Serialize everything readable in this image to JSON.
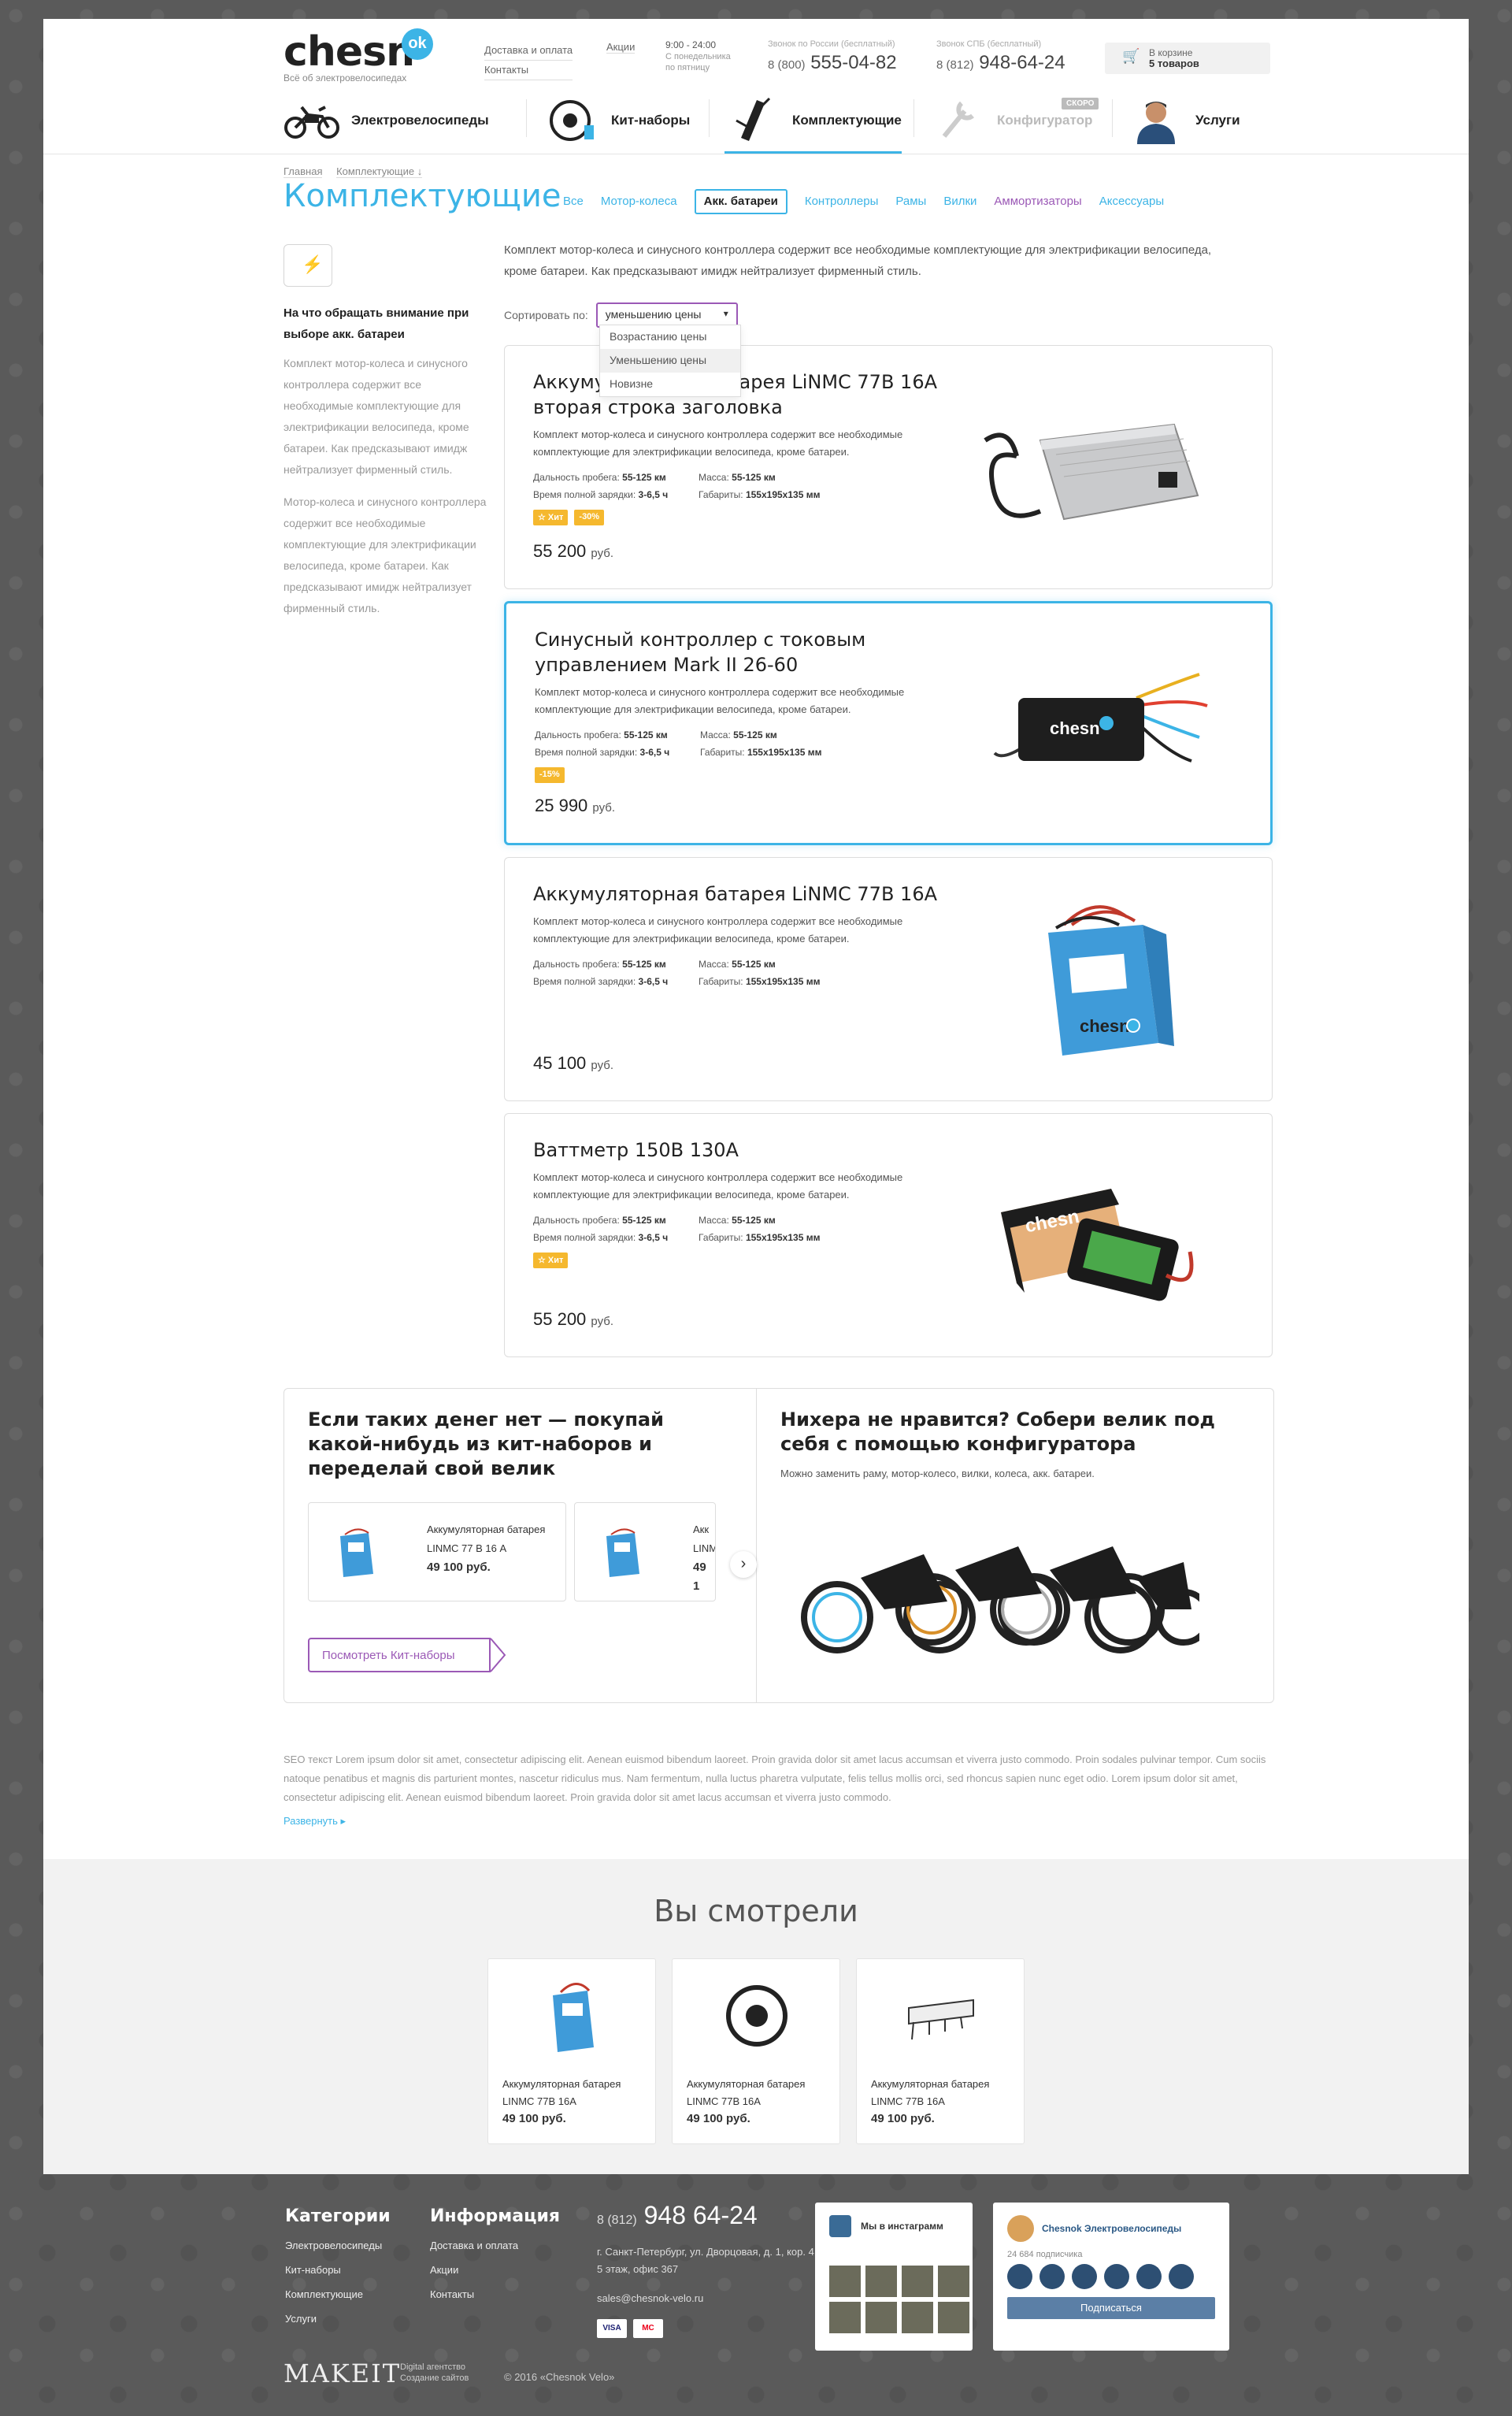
{
  "header": {
    "logo_text": "chesn",
    "logo_badge": "ok",
    "logo_sub": "Всё об электровелосипедах",
    "links": [
      "Доставка и оплата",
      "Контакты"
    ],
    "promo_link": "Акции",
    "hours_time": "9:00 - 24:00",
    "hours_days": "С понедельника\nпо пятницу",
    "phone_ru_label": "Звонок по России (бесплатный)",
    "phone_ru_code": "8 (800)",
    "phone_ru_num": "555-04-82",
    "phone_spb_label": "Звонок СПБ (бесплатный)",
    "phone_spb_code": "8 (812)",
    "phone_spb_num": "948-64-24",
    "cart_label": "В корзине",
    "cart_count": "5 товаров"
  },
  "nav": {
    "ebikes": "Электровелосипеды",
    "kits": "Кит-наборы",
    "parts": "Комплектующие",
    "configurator": "Конфигуратор",
    "soon": "СКОРО",
    "services": "Услуги"
  },
  "breadcrumbs": [
    "Главная",
    "Комплектующие ↓"
  ],
  "page_title": "Комплектующие",
  "categories": [
    "Все",
    "Мотор-колеса",
    "Акк. батареи",
    "Контроллеры",
    "Рамы",
    "Вилки",
    "Аммортизаторы",
    "Аксессуары"
  ],
  "sidebar": {
    "title": "На что обращать внимание при выборе акк. батареи",
    "text1": "Комплект мотор-колеса и синусного контроллера содержит все необходимые комплектующие для электрификации велосипеда, кроме батареи. Как предсказывают имидж нейтрализует фирменный стиль.",
    "text2": "Мотор-колеса и синусного контроллера содержит все необходимые комплектующие для электрификации велосипеда, кроме батареи. Как предсказывают имидж нейтрализует фирменный стиль."
  },
  "intro": "Комплект мотор-колеса и синусного контроллера содержит все необходимые комплектующие для электрификации велосипеда, кроме батареи. Как предсказывают имидж нейтрализует фирменный стиль.",
  "sort": {
    "label": "Сортировать по:",
    "selected": "уменьшению цены",
    "options": [
      "Возрастанию цены",
      "Уменьшению цены",
      "Новизне"
    ]
  },
  "products": [
    {
      "title": "Аккумуляторная батарея LiNMC 77В 16А вторая строка заголовка",
      "desc": "Комплект мотор-колеса и синусного контроллера содержит все необходимые комплектующие для электрификации велосипеда, кроме батареи.",
      "range_label": "Дальность пробега:",
      "range": "55-125 км",
      "mass_label": "Масса:",
      "mass": "55-125 км",
      "charge_label": "Время полной зарядки:",
      "charge": "3-6,5 ч",
      "size_label": "Габариты:",
      "size": "155х195х135 мм",
      "badges": [
        "☆ Хит",
        "-30%"
      ],
      "price": "55 200",
      "currency": "руб."
    },
    {
      "title": "Синусный контроллер с токовым управлением Mark II 26-60",
      "desc": "Комплект мотор-колеса и синусного контроллера содержит все необходимые комплектующие для электрификации велосипеда, кроме батареи.",
      "range_label": "Дальность пробега:",
      "range": "55-125 км",
      "mass_label": "Масса:",
      "mass": "55-125 км",
      "charge_label": "Время полной зарядки:",
      "charge": "3-6,5 ч",
      "size_label": "Габариты:",
      "size": "155х195х135 мм",
      "badges": [
        "-15%"
      ],
      "price": "25 990",
      "currency": "руб."
    },
    {
      "title": "Аккумуляторная батарея LiNMC 77В 16А",
      "desc": "Комплект мотор-колеса и синусного контроллера содержит все необходимые комплектующие для электрификации велосипеда, кроме батареи.",
      "range_label": "Дальность пробега:",
      "range": "55-125 км",
      "mass_label": "Масса:",
      "mass": "55-125 км",
      "charge_label": "Время полной зарядки:",
      "charge": "3-6,5 ч",
      "size_label": "Габариты:",
      "size": "155х195х135 мм",
      "badges": [],
      "price": "45 100",
      "currency": "руб."
    },
    {
      "title": "Ваттметр 150В 130А",
      "desc": "Комплект мотор-колеса и синусного контроллера содержит все необходимые комплектующие для электрификации велосипеда, кроме батареи.",
      "range_label": "Дальность пробега:",
      "range": "55-125 км",
      "mass_label": "Масса:",
      "mass": "55-125 км",
      "charge_label": "Время полной зарядки:",
      "charge": "3-6,5 ч",
      "size_label": "Габариты:",
      "size": "155х195х135 мм",
      "badges": [
        "☆ Хит"
      ],
      "price": "55 200",
      "currency": "руб."
    }
  ],
  "promo": {
    "left_title": "Если таких денег нет — покупай какой-нибудь из кит-наборов и переделай свой велик",
    "mini_name": "Аккумуляторная батарея LINMC 77 В 16 А",
    "mini_price": "49 100 руб.",
    "mini2_name": "Акк LINMC",
    "mini2_price": "49 1",
    "kit_button": "Посмотреть Кит-наборы",
    "right_title": "Нихера не нравится? Собери велик под себя с помощью конфигуратора",
    "right_sub": "Можно заменить раму, мотор-колесо, вилки, колеса, акк. батареи."
  },
  "seo": {
    "text": "SEO текст Lorem ipsum dolor sit amet, consectetur adipiscing elit. Aenean euismod bibendum laoreet. Proin gravida dolor sit amet lacus accumsan et viverra justo commodo. Proin sodales pulvinar tempor. Cum sociis natoque penatibus et magnis dis parturient montes, nascetur ridiculus mus. Nam fermentum, nulla luctus pharetra vulputate, felis tellus mollis orci, sed rhoncus sapien nunc eget odio. Lorem ipsum dolor sit amet, consectetur adipiscing elit. Aenean euismod bibendum laoreet. Proin gravida dolor sit amet lacus accumsan et viverra justo commodo.",
    "more": "Развернуть ▸"
  },
  "viewed": {
    "title": "Вы смотрели",
    "items": [
      {
        "name": "Аккумуляторная батарея LINMC 77В 16А",
        "price": "49 100 руб."
      },
      {
        "name": "Аккумуляторная батарея LINMC 77В 16А",
        "price": "49 100 руб."
      },
      {
        "name": "Аккумуляторная батарея LINMC 77В 16А",
        "price": "49 100 руб."
      }
    ]
  },
  "footer": {
    "categories_title": "Категории",
    "categories": [
      "Электровелосипеды",
      "Кит-наборы",
      "Комплектующие",
      "Услуги"
    ],
    "info_title": "Информация",
    "info": [
      "Доставка и оплата",
      "Акции",
      "Контакты"
    ],
    "phone_code": "8 (812)",
    "phone": "948 64-24",
    "address": "г. Санкт-Петербург, ул. Дворцовая, д. 1, кор. 4, 5 этаж, офис 367",
    "email": "sales@chesnok-velo.ru",
    "pay": [
      "VISA",
      "MC"
    ],
    "insta_title": "Мы в инстаграмм",
    "vk_title": "Chesnok Электровелосипеды",
    "vk_subs": "24 684 подписчика",
    "vk_button": "Подписаться",
    "makeit": "MAKEIT",
    "makeit_sub": "Digital агентство\nСоздание сайтов",
    "copyright": "© 2016 «Chesnok Velo»"
  },
  "colors": {
    "accent": "#3cb4e6",
    "purple": "#9b59b6",
    "badge": "#f5b82e"
  }
}
